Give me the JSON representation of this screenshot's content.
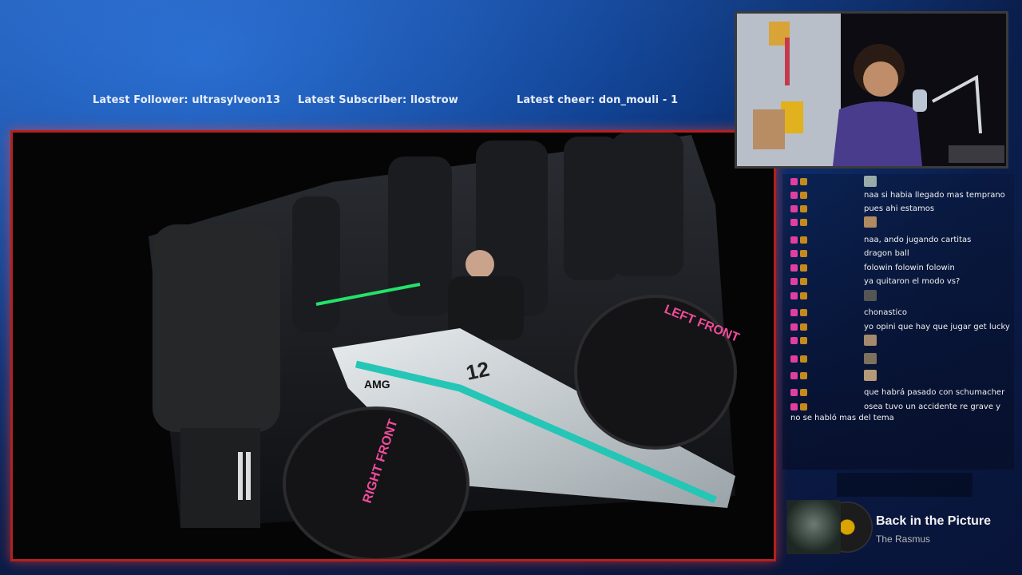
{
  "alerts": {
    "follower": "Latest Follower: ultrasylveon13",
    "subscriber": "Latest Subscriber: llostrow",
    "cheer": "Latest cheer: don_mouli - 1"
  },
  "video": {
    "tire_labels": [
      "LEFT FRONT",
      "RIGHT FRONT"
    ],
    "car_number": "12",
    "sponsor": "AMG"
  },
  "chat": {
    "messages": [
      {
        "msg": "",
        "emote": true
      },
      {
        "msg": "naa si habia llegado mas temprano"
      },
      {
        "msg": "pues ahi estamos"
      },
      {
        "msg": "",
        "emote": true
      },
      {
        "msg": "naa, ando jugando cartitas"
      },
      {
        "msg": "dragon ball"
      },
      {
        "msg": "folowin folowin folowin"
      },
      {
        "msg": "ya quitaron el modo vs?"
      },
      {
        "msg": "",
        "emote": true
      },
      {
        "msg": "chonastico"
      },
      {
        "msg": "yo opini que hay que jugar get lucky"
      },
      {
        "msg": "",
        "emote": true
      },
      {
        "msg": "",
        "emote": true
      },
      {
        "msg": "",
        "emote": true
      },
      {
        "msg": "que habrá pasado con schumacher"
      },
      {
        "msg": "osea tuvo un accidente re grave y no se habló mas del tema"
      }
    ]
  },
  "now_playing": {
    "title": "Back in the Picture",
    "artist": "The Rasmus"
  }
}
